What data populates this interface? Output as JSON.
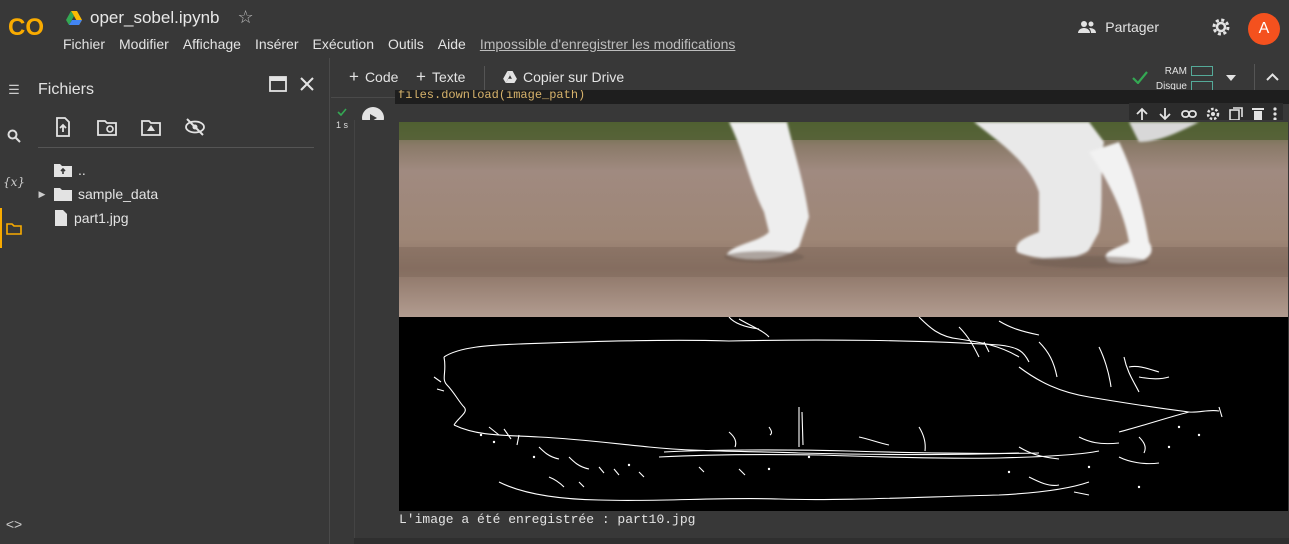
{
  "app": {
    "logo_text": "CO",
    "doc_title": "oper_sobel.ipynb",
    "menu": [
      "Fichier",
      "Modifier",
      "Affichage",
      "Insérer",
      "Exécution",
      "Outils",
      "Aide"
    ],
    "save_warning": "Impossible d'enregistrer les modifications",
    "share_label": "Partager",
    "avatar_letter": "A"
  },
  "files_panel": {
    "title": "Fichiers",
    "tree": [
      {
        "label": "..",
        "icon": "folder-up-icon"
      },
      {
        "label": "sample_data",
        "icon": "folder-icon",
        "collapsible": true
      },
      {
        "label": "part1.jpg",
        "icon": "file-icon"
      }
    ]
  },
  "toolbar": {
    "add_code": "Code",
    "add_text": "Texte",
    "copy_drive": "Copier sur Drive",
    "ram_label": "RAM",
    "disk_label": "Disque"
  },
  "cell": {
    "exec_time": "1 s",
    "code_fragment": "files.download(image_path)",
    "output_text": "L'image a été enregistrée : part10.jpg"
  },
  "colors": {
    "accent": "#f9ab00",
    "avatar": "#f4511e",
    "ok_check": "#34a853"
  }
}
